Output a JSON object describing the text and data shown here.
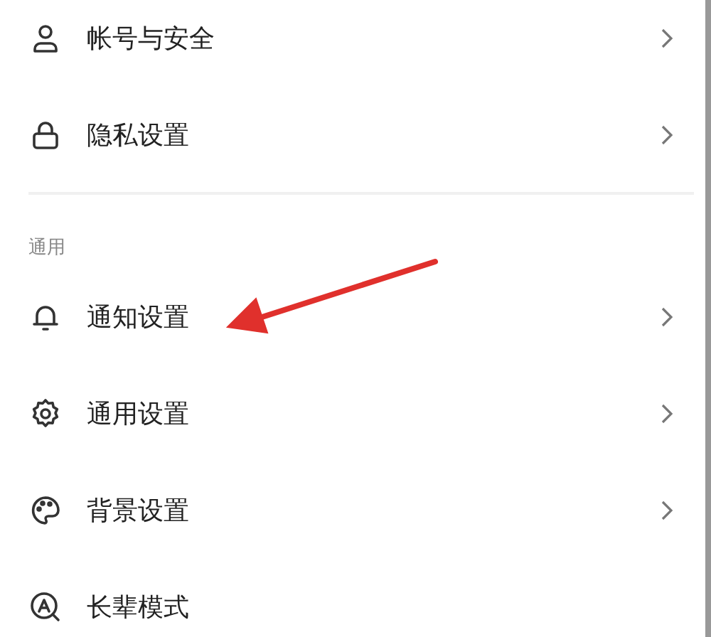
{
  "sections": [
    {
      "items": [
        {
          "label": "帐号与安全",
          "chevron": true
        },
        {
          "label": "隐私设置",
          "chevron": true
        }
      ]
    },
    {
      "header": "通用",
      "items": [
        {
          "label": "通知设置",
          "chevron": true
        },
        {
          "label": "通用设置",
          "chevron": true
        },
        {
          "label": "背景设置",
          "chevron": true
        },
        {
          "label": "长辈模式",
          "chevron": false
        }
      ]
    }
  ],
  "annotation": {
    "kind": "arrow",
    "color": "#e0302c"
  }
}
